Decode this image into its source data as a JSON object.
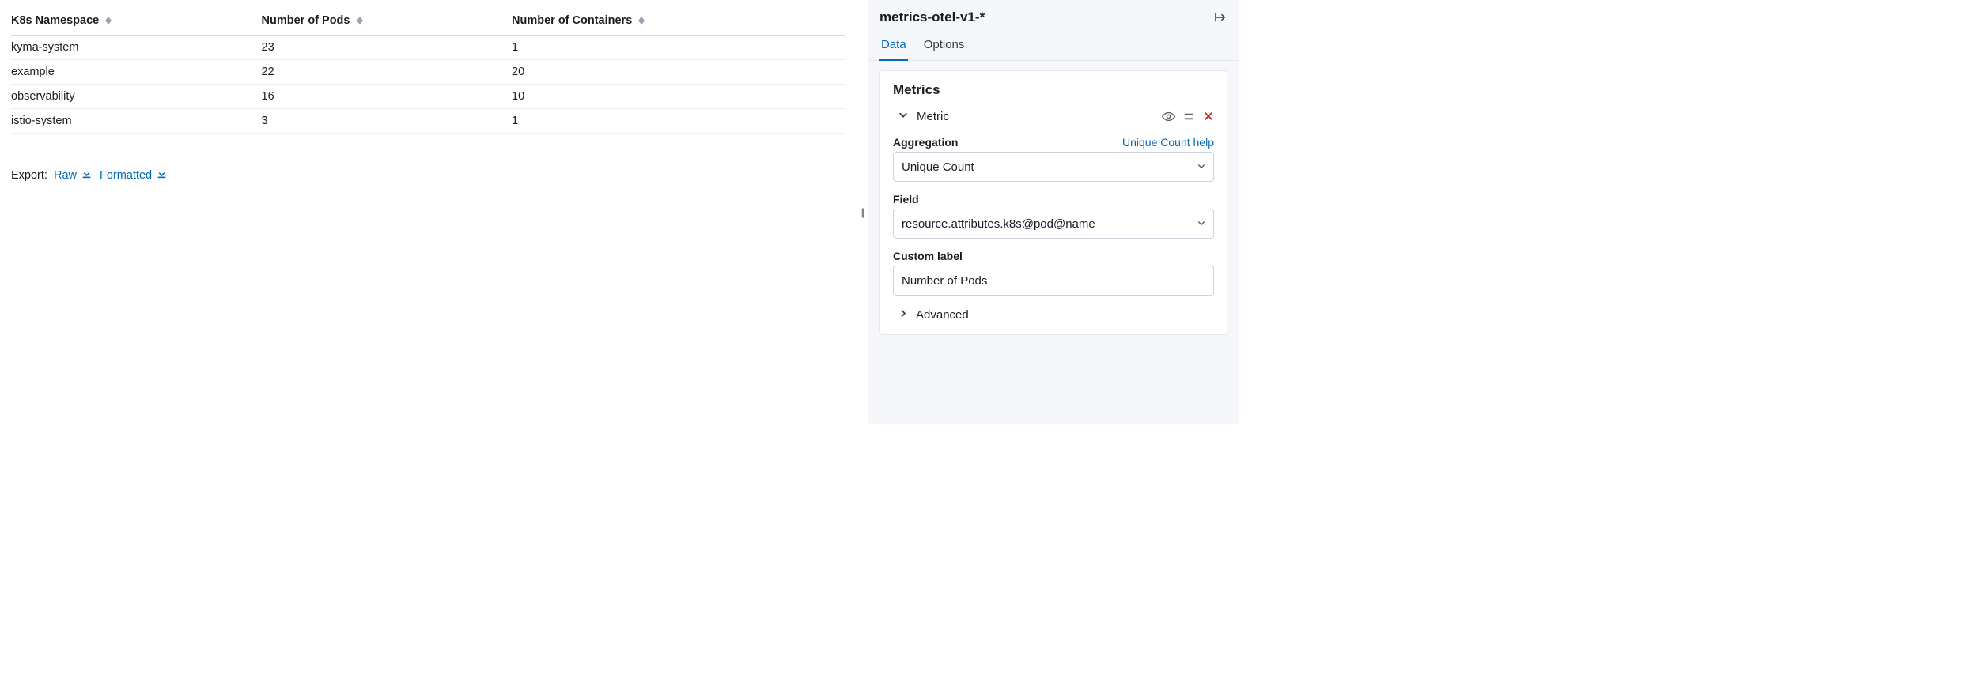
{
  "table": {
    "columns": [
      {
        "label": "K8s Namespace"
      },
      {
        "label": "Number of Pods"
      },
      {
        "label": "Number of Containers"
      }
    ],
    "rows": [
      {
        "ns": "kyma-system",
        "pods": "23",
        "containers": "1"
      },
      {
        "ns": "example",
        "pods": "22",
        "containers": "20"
      },
      {
        "ns": "observability",
        "pods": "16",
        "containers": "10"
      },
      {
        "ns": "istio-system",
        "pods": "3",
        "containers": "1"
      }
    ]
  },
  "export": {
    "label": "Export:",
    "raw": "Raw",
    "formatted": "Formatted"
  },
  "sidebar": {
    "title": "metrics-otel-v1-*",
    "tabs": {
      "data": "Data",
      "options": "Options"
    },
    "panel_title": "Metrics",
    "metric_label": "Metric",
    "aggregation": {
      "label": "Aggregation",
      "help": "Unique Count help",
      "value": "Unique Count"
    },
    "field": {
      "label": "Field",
      "value": "resource.attributes.k8s@pod@name"
    },
    "custom_label": {
      "label": "Custom label",
      "value": "Number of Pods"
    },
    "advanced": "Advanced"
  }
}
